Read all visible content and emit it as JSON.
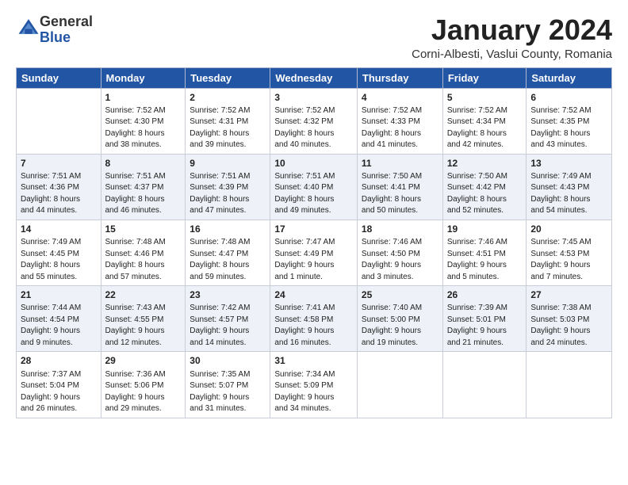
{
  "logo": {
    "general": "General",
    "blue": "Blue"
  },
  "title": {
    "month_year": "January 2024",
    "location": "Corni-Albesti, Vaslui County, Romania"
  },
  "weekdays": [
    "Sunday",
    "Monday",
    "Tuesday",
    "Wednesday",
    "Thursday",
    "Friday",
    "Saturday"
  ],
  "weeks": [
    [
      {
        "day": "",
        "info": ""
      },
      {
        "day": "1",
        "info": "Sunrise: 7:52 AM\nSunset: 4:30 PM\nDaylight: 8 hours\nand 38 minutes."
      },
      {
        "day": "2",
        "info": "Sunrise: 7:52 AM\nSunset: 4:31 PM\nDaylight: 8 hours\nand 39 minutes."
      },
      {
        "day": "3",
        "info": "Sunrise: 7:52 AM\nSunset: 4:32 PM\nDaylight: 8 hours\nand 40 minutes."
      },
      {
        "day": "4",
        "info": "Sunrise: 7:52 AM\nSunset: 4:33 PM\nDaylight: 8 hours\nand 41 minutes."
      },
      {
        "day": "5",
        "info": "Sunrise: 7:52 AM\nSunset: 4:34 PM\nDaylight: 8 hours\nand 42 minutes."
      },
      {
        "day": "6",
        "info": "Sunrise: 7:52 AM\nSunset: 4:35 PM\nDaylight: 8 hours\nand 43 minutes."
      }
    ],
    [
      {
        "day": "7",
        "info": "Sunrise: 7:51 AM\nSunset: 4:36 PM\nDaylight: 8 hours\nand 44 minutes."
      },
      {
        "day": "8",
        "info": "Sunrise: 7:51 AM\nSunset: 4:37 PM\nDaylight: 8 hours\nand 46 minutes."
      },
      {
        "day": "9",
        "info": "Sunrise: 7:51 AM\nSunset: 4:39 PM\nDaylight: 8 hours\nand 47 minutes."
      },
      {
        "day": "10",
        "info": "Sunrise: 7:51 AM\nSunset: 4:40 PM\nDaylight: 8 hours\nand 49 minutes."
      },
      {
        "day": "11",
        "info": "Sunrise: 7:50 AM\nSunset: 4:41 PM\nDaylight: 8 hours\nand 50 minutes."
      },
      {
        "day": "12",
        "info": "Sunrise: 7:50 AM\nSunset: 4:42 PM\nDaylight: 8 hours\nand 52 minutes."
      },
      {
        "day": "13",
        "info": "Sunrise: 7:49 AM\nSunset: 4:43 PM\nDaylight: 8 hours\nand 54 minutes."
      }
    ],
    [
      {
        "day": "14",
        "info": "Sunrise: 7:49 AM\nSunset: 4:45 PM\nDaylight: 8 hours\nand 55 minutes."
      },
      {
        "day": "15",
        "info": "Sunrise: 7:48 AM\nSunset: 4:46 PM\nDaylight: 8 hours\nand 57 minutes."
      },
      {
        "day": "16",
        "info": "Sunrise: 7:48 AM\nSunset: 4:47 PM\nDaylight: 8 hours\nand 59 minutes."
      },
      {
        "day": "17",
        "info": "Sunrise: 7:47 AM\nSunset: 4:49 PM\nDaylight: 9 hours\nand 1 minute."
      },
      {
        "day": "18",
        "info": "Sunrise: 7:46 AM\nSunset: 4:50 PM\nDaylight: 9 hours\nand 3 minutes."
      },
      {
        "day": "19",
        "info": "Sunrise: 7:46 AM\nSunset: 4:51 PM\nDaylight: 9 hours\nand 5 minutes."
      },
      {
        "day": "20",
        "info": "Sunrise: 7:45 AM\nSunset: 4:53 PM\nDaylight: 9 hours\nand 7 minutes."
      }
    ],
    [
      {
        "day": "21",
        "info": "Sunrise: 7:44 AM\nSunset: 4:54 PM\nDaylight: 9 hours\nand 9 minutes."
      },
      {
        "day": "22",
        "info": "Sunrise: 7:43 AM\nSunset: 4:55 PM\nDaylight: 9 hours\nand 12 minutes."
      },
      {
        "day": "23",
        "info": "Sunrise: 7:42 AM\nSunset: 4:57 PM\nDaylight: 9 hours\nand 14 minutes."
      },
      {
        "day": "24",
        "info": "Sunrise: 7:41 AM\nSunset: 4:58 PM\nDaylight: 9 hours\nand 16 minutes."
      },
      {
        "day": "25",
        "info": "Sunrise: 7:40 AM\nSunset: 5:00 PM\nDaylight: 9 hours\nand 19 minutes."
      },
      {
        "day": "26",
        "info": "Sunrise: 7:39 AM\nSunset: 5:01 PM\nDaylight: 9 hours\nand 21 minutes."
      },
      {
        "day": "27",
        "info": "Sunrise: 7:38 AM\nSunset: 5:03 PM\nDaylight: 9 hours\nand 24 minutes."
      }
    ],
    [
      {
        "day": "28",
        "info": "Sunrise: 7:37 AM\nSunset: 5:04 PM\nDaylight: 9 hours\nand 26 minutes."
      },
      {
        "day": "29",
        "info": "Sunrise: 7:36 AM\nSunset: 5:06 PM\nDaylight: 9 hours\nand 29 minutes."
      },
      {
        "day": "30",
        "info": "Sunrise: 7:35 AM\nSunset: 5:07 PM\nDaylight: 9 hours\nand 31 minutes."
      },
      {
        "day": "31",
        "info": "Sunrise: 7:34 AM\nSunset: 5:09 PM\nDaylight: 9 hours\nand 34 minutes."
      },
      {
        "day": "",
        "info": ""
      },
      {
        "day": "",
        "info": ""
      },
      {
        "day": "",
        "info": ""
      }
    ]
  ]
}
